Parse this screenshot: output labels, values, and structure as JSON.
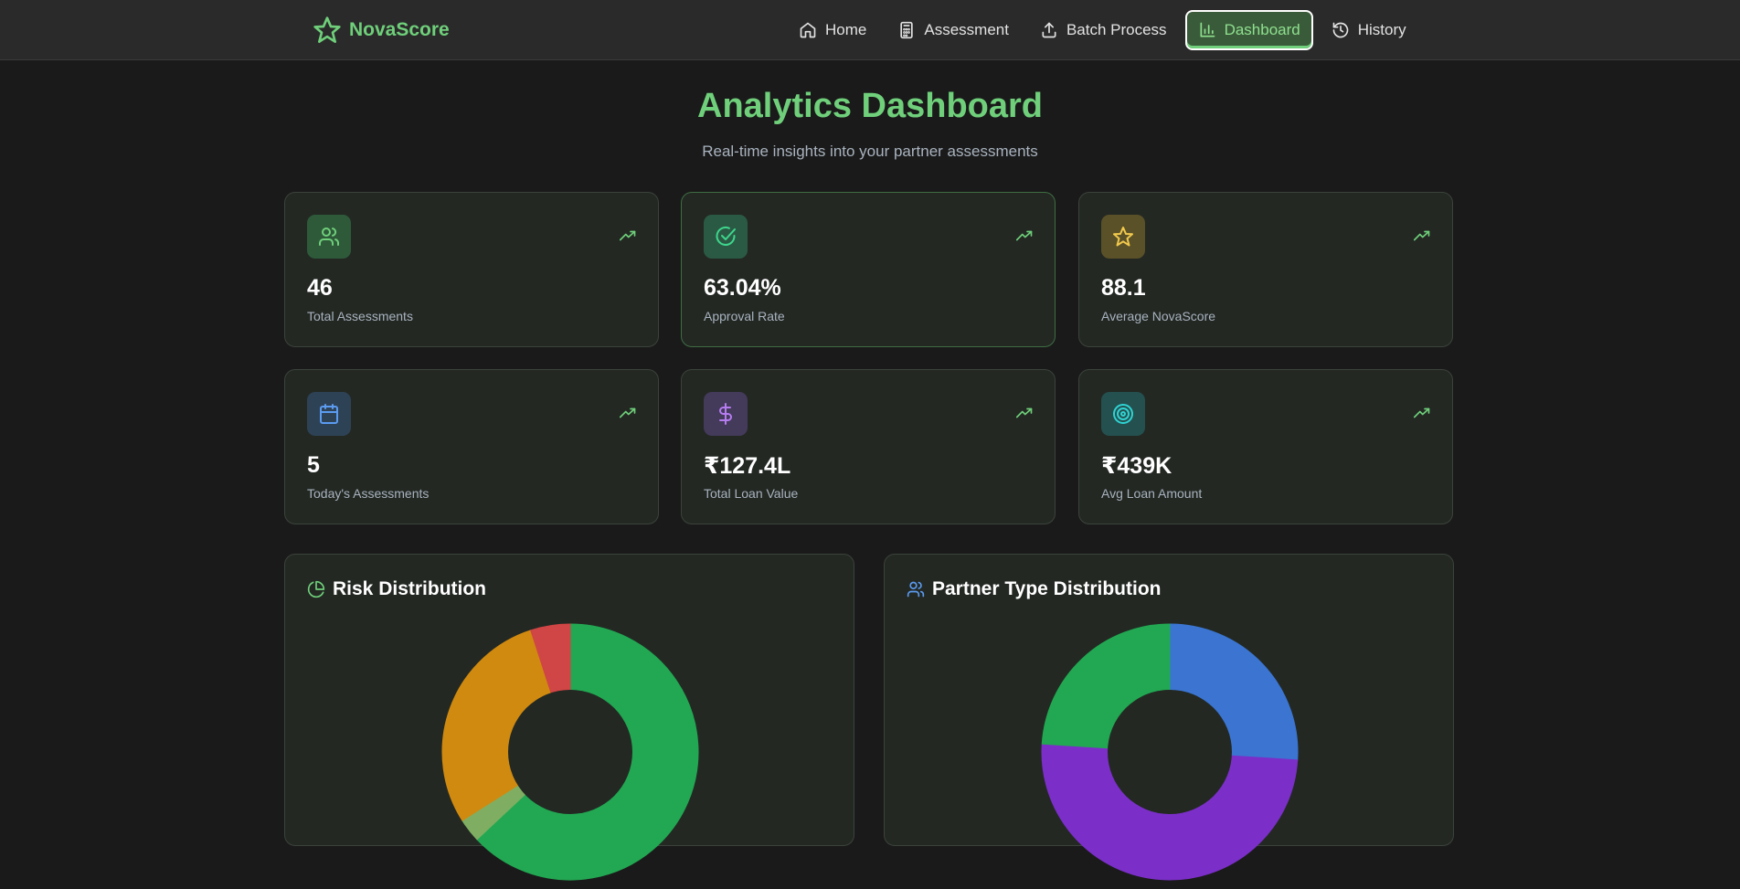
{
  "app": {
    "brand": "NovaScore",
    "brand_color": "#6fcf7a"
  },
  "nav": {
    "items": [
      {
        "label": "Home",
        "icon": "home-icon",
        "active": false
      },
      {
        "label": "Assessment",
        "icon": "calculator-icon",
        "active": false
      },
      {
        "label": "Batch Process",
        "icon": "upload-icon",
        "active": false
      },
      {
        "label": "Dashboard",
        "icon": "bar-chart-icon",
        "active": true
      },
      {
        "label": "History",
        "icon": "history-icon",
        "active": false
      }
    ]
  },
  "page": {
    "title": "Analytics Dashboard",
    "subtitle": "Real-time insights into your partner assessments"
  },
  "stats": [
    {
      "value": "46",
      "label": "Total Assessments",
      "icon": "users-icon",
      "trend_icon": "trending-up-icon"
    },
    {
      "value": "63.04%",
      "label": "Approval Rate",
      "icon": "check-circle-icon",
      "trend_icon": "trending-up-icon"
    },
    {
      "value": "88.1",
      "label": "Average NovaScore",
      "icon": "star-icon",
      "trend_icon": "trending-up-icon"
    },
    {
      "value": "5",
      "label": "Today's Assessments",
      "icon": "calendar-icon",
      "trend_icon": "trending-up-icon"
    },
    {
      "value": "₹127.4L",
      "label": "Total Loan Value",
      "icon": "dollar-icon",
      "trend_icon": "trending-up-icon"
    },
    {
      "value": "₹439K",
      "label": "Avg Loan Amount",
      "icon": "target-icon",
      "trend_icon": "trending-up-icon"
    }
  ],
  "panels": {
    "risk": {
      "title": "Risk Distribution",
      "icon": "pie-chart-icon"
    },
    "partner": {
      "title": "Partner Type Distribution",
      "icon": "users-icon"
    }
  },
  "chart_data": [
    {
      "type": "pie",
      "title": "Risk Distribution",
      "slices": [
        {
          "value": 63,
          "color": "#22a852"
        },
        {
          "value": 3,
          "color": "#7fae62"
        },
        {
          "value": 29,
          "color": "#d08a10"
        },
        {
          "value": 5,
          "color": "#d04545"
        }
      ]
    },
    {
      "type": "pie",
      "title": "Partner Type Distribution",
      "slices": [
        {
          "value": 26,
          "color": "#3b75d1"
        },
        {
          "value": 50,
          "color": "#7b2fc8"
        },
        {
          "value": 24,
          "color": "#22a852"
        }
      ]
    }
  ]
}
